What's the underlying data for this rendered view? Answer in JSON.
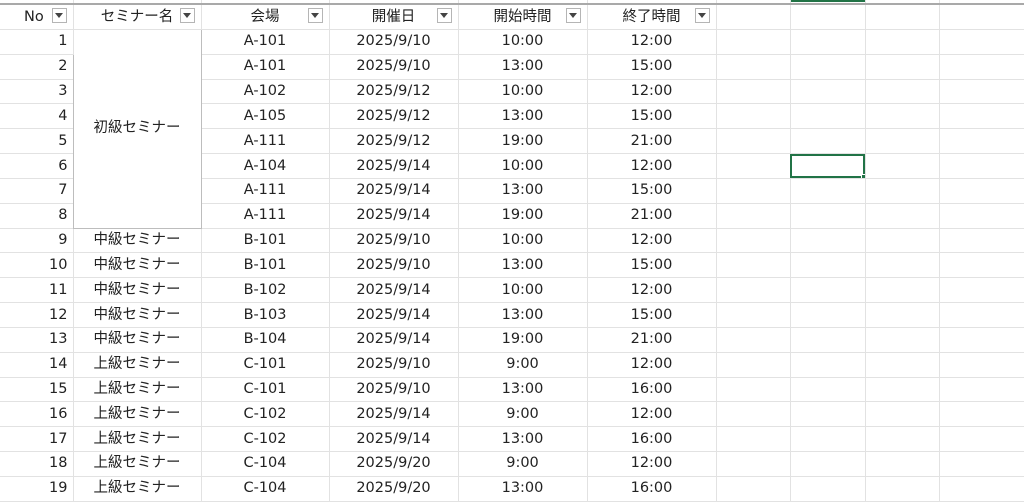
{
  "headers": {
    "no": "No",
    "seminar": "セミナー名",
    "venue": "会場",
    "date": "開催日",
    "start": "開始時間",
    "end": "終了時間"
  },
  "filter_icon": "dropdown-arrow-icon",
  "accent_color": "#217346",
  "merged_label": "初級セミナー",
  "rows": [
    {
      "no": "1",
      "seminar": "",
      "venue": "A-101",
      "date": "2025/9/10",
      "start": "10:00",
      "end": "12:00"
    },
    {
      "no": "2",
      "seminar": "",
      "venue": "A-101",
      "date": "2025/9/10",
      "start": "13:00",
      "end": "15:00"
    },
    {
      "no": "3",
      "seminar": "",
      "venue": "A-102",
      "date": "2025/9/12",
      "start": "10:00",
      "end": "12:00"
    },
    {
      "no": "4",
      "seminar": "",
      "venue": "A-105",
      "date": "2025/9/12",
      "start": "13:00",
      "end": "15:00"
    },
    {
      "no": "5",
      "seminar": "",
      "venue": "A-111",
      "date": "2025/9/12",
      "start": "19:00",
      "end": "21:00"
    },
    {
      "no": "6",
      "seminar": "",
      "venue": "A-104",
      "date": "2025/9/14",
      "start": "10:00",
      "end": "12:00"
    },
    {
      "no": "7",
      "seminar": "",
      "venue": "A-111",
      "date": "2025/9/14",
      "start": "13:00",
      "end": "15:00"
    },
    {
      "no": "8",
      "seminar": "",
      "venue": "A-111",
      "date": "2025/9/14",
      "start": "19:00",
      "end": "21:00"
    },
    {
      "no": "9",
      "seminar": "中級セミナー",
      "venue": "B-101",
      "date": "2025/9/10",
      "start": "10:00",
      "end": "12:00"
    },
    {
      "no": "10",
      "seminar": "中級セミナー",
      "venue": "B-101",
      "date": "2025/9/10",
      "start": "13:00",
      "end": "15:00"
    },
    {
      "no": "11",
      "seminar": "中級セミナー",
      "venue": "B-102",
      "date": "2025/9/14",
      "start": "10:00",
      "end": "12:00"
    },
    {
      "no": "12",
      "seminar": "中級セミナー",
      "venue": "B-103",
      "date": "2025/9/14",
      "start": "13:00",
      "end": "15:00"
    },
    {
      "no": "13",
      "seminar": "中級セミナー",
      "venue": "B-104",
      "date": "2025/9/14",
      "start": "19:00",
      "end": "21:00"
    },
    {
      "no": "14",
      "seminar": "上級セミナー",
      "venue": "C-101",
      "date": "2025/9/10",
      "start": "9:00",
      "end": "12:00"
    },
    {
      "no": "15",
      "seminar": "上級セミナー",
      "venue": "C-101",
      "date": "2025/9/10",
      "start": "13:00",
      "end": "16:00"
    },
    {
      "no": "16",
      "seminar": "上級セミナー",
      "venue": "C-102",
      "date": "2025/9/14",
      "start": "9:00",
      "end": "12:00"
    },
    {
      "no": "17",
      "seminar": "上級セミナー",
      "venue": "C-102",
      "date": "2025/9/14",
      "start": "13:00",
      "end": "16:00"
    },
    {
      "no": "18",
      "seminar": "上級セミナー",
      "venue": "C-104",
      "date": "2025/9/20",
      "start": "9:00",
      "end": "12:00"
    },
    {
      "no": "19",
      "seminar": "上級セミナー",
      "venue": "C-104",
      "date": "2025/9/20",
      "start": "13:00",
      "end": "16:00"
    }
  ]
}
